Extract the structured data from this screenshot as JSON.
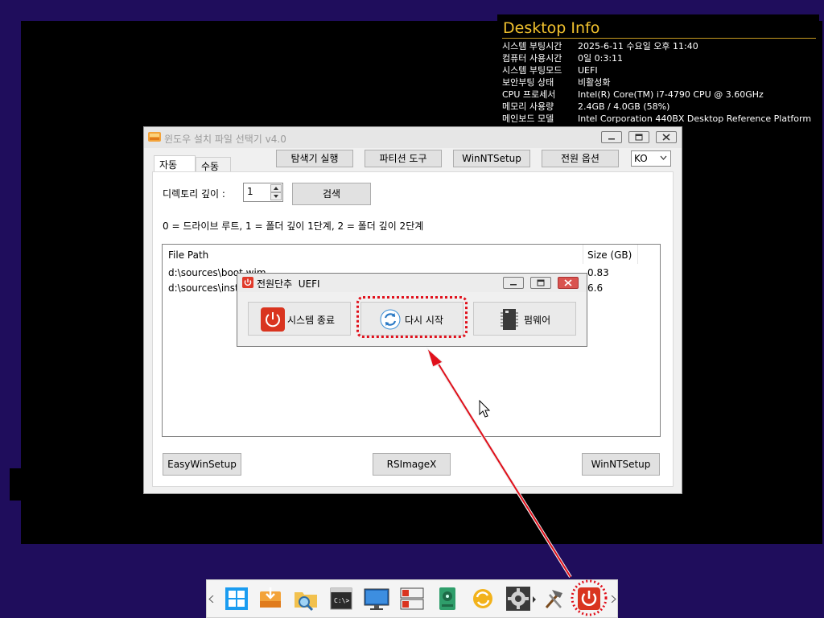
{
  "desktop_info": {
    "title": "Desktop Info",
    "rows": [
      {
        "label": "시스템 부팅시간",
        "value": "2025-6-11 수요일 오후 11:40"
      },
      {
        "label": "컴퓨터 사용시간",
        "value": "0일 0:3:11"
      },
      {
        "label": "시스템 부팅모드",
        "value": "UEFI"
      },
      {
        "label": "보안부팅 상태",
        "value": "비활성화"
      },
      {
        "label": "CPU 프로세서",
        "value": "Intel(R) Core(TM) i7-4790 CPU @ 3.60GHz"
      },
      {
        "label": "메모리 사용량",
        "value": "2.4GB / 4.0GB (58%)"
      },
      {
        "label": "메인보드 모델",
        "value": "Intel Corporation 440BX Desktop Reference Platform"
      }
    ]
  },
  "main_window": {
    "title": "윈도우 설치 파일 선택기 v4.0",
    "tabs": [
      {
        "label": "자동"
      },
      {
        "label": "수동"
      }
    ],
    "toolbar": {
      "explorer": "탐색기 실행",
      "partition": "파티션 도구",
      "winntsetup": "WinNTSetup",
      "power": "전원 옵션",
      "language": "KO"
    },
    "depth_label": "디렉토리 깊이 :",
    "depth_value": "1",
    "search_button": "검색",
    "hint": "0 = 드라이브 루트, 1 = 폴더 깊이 1단계, 2 = 폴더 깊이 2단계",
    "list": {
      "col_path": "File Path",
      "col_size": "Size (GB)",
      "rows": [
        {
          "path": "d:\\sources\\boot.wim",
          "size": "0.83"
        },
        {
          "path": "d:\\sources\\install.wim",
          "size": "6.6"
        }
      ]
    },
    "bottom": {
      "easywinsetup": "EasyWinSetup",
      "rsimagex": "RSImageX",
      "winntsetup": "WinNTSetup"
    }
  },
  "power_dialog": {
    "title": "전원단추  UEFI",
    "buttons": {
      "shutdown": "시스템 종료",
      "restart": "다시 시작",
      "firmware": "펌웨어"
    }
  },
  "colors": {
    "desktop_bg": "#1f0d5c",
    "info_title": "#f2c22e",
    "highlight": "#e0101b"
  }
}
